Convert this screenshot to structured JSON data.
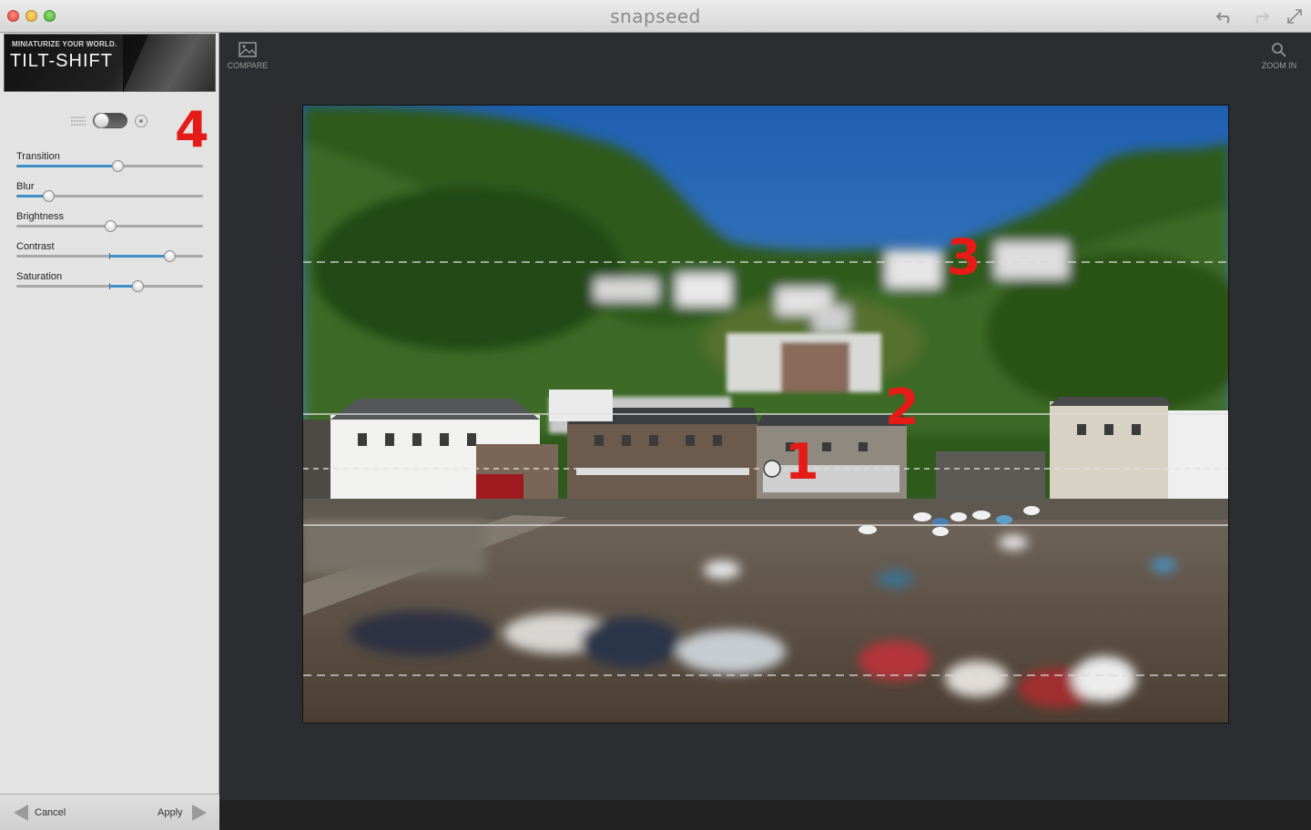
{
  "window": {
    "title": "snapseed"
  },
  "toolbar": {
    "undo_icon": "undo-icon",
    "redo_icon": "redo-icon",
    "fullscreen_icon": "fullscreen-icon"
  },
  "sidebar": {
    "banner_tagline": "MINIATURIZE YOUR WORLD.",
    "banner_tool": "TILT-SHIFT",
    "sliders": [
      {
        "label": "Transition",
        "value": 0.54,
        "bipolar": false
      },
      {
        "label": "Blur",
        "value": 0.17,
        "bipolar": false
      },
      {
        "label": "Brightness",
        "value": 0.5,
        "bipolar": true
      },
      {
        "label": "Contrast",
        "value": 0.82,
        "bipolar": true
      },
      {
        "label": "Saturation",
        "value": 0.65,
        "bipolar": true
      }
    ],
    "cancel_label": "Cancel",
    "apply_label": "Apply"
  },
  "main": {
    "compare_label": "COMPARE",
    "zoom_label": "ZOOM IN"
  },
  "annotations": [
    "1",
    "2",
    "3",
    "4"
  ]
}
